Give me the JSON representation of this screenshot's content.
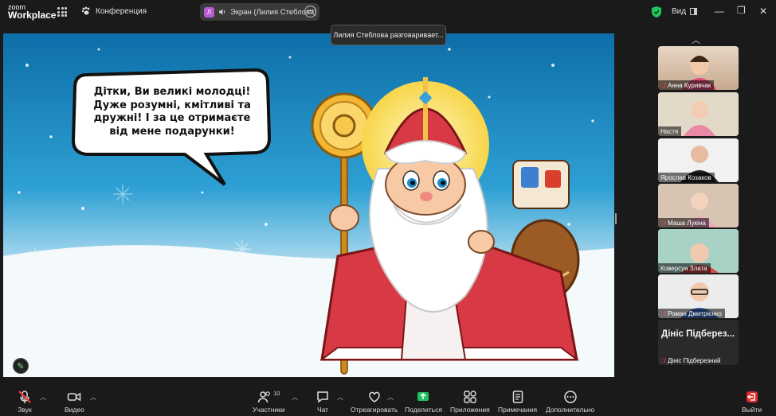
{
  "app": {
    "logo_top": "zoom",
    "logo_bottom": "Workplace"
  },
  "header": {
    "meeting_label": "Конференция",
    "share_initial": "Л",
    "share_label": "Экран (Лилия Стеблова)",
    "view_label": "Вид"
  },
  "toast": {
    "text": "Лилия Стеблова разговаривает..."
  },
  "slide": {
    "bubble_lines": [
      "Дітки, Ви великі молодці!",
      "Дуже розумні, кмітливі та",
      "дружні! І за це отримаєте",
      "від мене подарунки!"
    ]
  },
  "participants": [
    {
      "name": "Анна Куривчак",
      "muted": true
    },
    {
      "name": "Настя",
      "muted": false
    },
    {
      "name": "Ярослав  Козаков",
      "muted": false
    },
    {
      "name": "Маша Лукіна",
      "muted": true
    },
    {
      "name": "Коверсун Злата",
      "muted": false
    },
    {
      "name": "Роман Дмитрієнко",
      "muted": true
    },
    {
      "name": "Дініс Підберезний",
      "muted": true,
      "display_title": "Дініс Підберез..."
    }
  ],
  "toolbar": {
    "audio": "Звук",
    "video": "Видео",
    "participants": "Участники",
    "participants_count": "10",
    "chat": "Чат",
    "react": "Отреагировать",
    "share": "Поделиться",
    "apps": "Приложения",
    "notes": "Примечания",
    "more": "Дополнительно",
    "leave": "Выйти"
  },
  "colors": {
    "share_green": "#1fbf5f",
    "leave_red": "#e02828",
    "accent_purple": "#b55bd6",
    "shield_green": "#22c55e"
  }
}
